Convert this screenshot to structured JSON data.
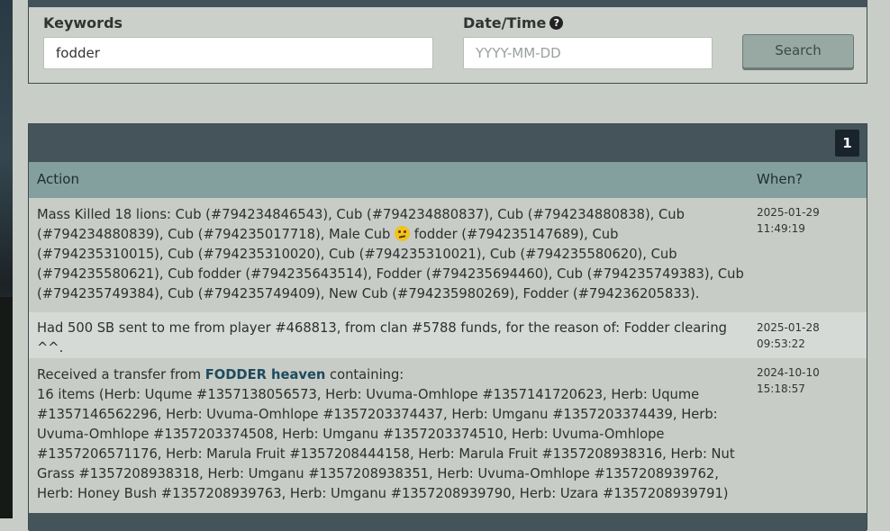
{
  "search": {
    "keywords_label": "Keywords",
    "keywords_value": "fodder",
    "date_label": "Date/Time",
    "date_placeholder": "YYYY-MM-DD",
    "search_button": "Search"
  },
  "results": {
    "page": "1",
    "columns": {
      "action": "Action",
      "when": "When?"
    },
    "rows": [
      {
        "action_a": "Mass Killed 18 lions: Cub (#794234846543), Cub (#794234880837), Cub (#794234880838), Cub (#794234880839), Cub (#794235017718), Male Cub",
        "action_b": "fodder (#794235147689), Cub (#794235310015), Cub (#794235310020), Cub (#794235310021), Cub (#794235580620), Cub (#794235580621), Cub fodder (#794235643514), Fodder (#794235694460), Cub (#794235749383), Cub (#794235749384), Cub (#794235749409), New Cub (#794235980269), Fodder (#794236205833).",
        "date": "2025-01-29",
        "time": "11:49:19"
      },
      {
        "action": "Had 500 SB sent to me from player #468813, from clan #5788 funds, for the reason of: Fodder clearing ^^.",
        "date": "2025-01-28",
        "time": "09:53:22"
      },
      {
        "action_prefix": "Received a transfer from",
        "action_link": "FODDER heaven",
        "action_suffix": "containing:",
        "items": "16 items (Herb: Uqume #1357138056573, Herb: Uvuma-Omhlope #1357141720623, Herb: Uqume #1357146562296, Herb: Uvuma-Omhlope #1357203374437, Herb: Umganu #1357203374439, Herb: Uvuma-Omhlope #1357203374508, Herb: Umganu #1357203374510, Herb: Uvuma-Omhlope #1357206571176, Herb: Marula Fruit #1357208444158, Herb: Marula Fruit #1357208938316, Herb: Nut Grass #1357208938318, Herb: Umganu #1357208938351, Herb: Uvuma-Omhlope #1357208939762, Herb: Honey Bush #1357208939763, Herb: Umganu #1357208939790, Herb: Uzara #1357208939791)",
        "date": "2024-10-10",
        "time": "15:18:57"
      }
    ]
  },
  "icons": {
    "help": "question-circle-icon",
    "emoji": "worried-face-emoji"
  }
}
